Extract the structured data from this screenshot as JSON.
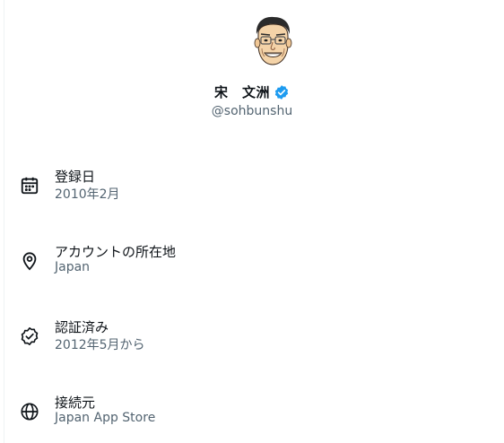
{
  "profile": {
    "display_name": "宋　文洲",
    "handle": "@sohbunshu",
    "verified_badge_icon": "verified-badge-icon",
    "verified_color": "#1d9bf0"
  },
  "details": [
    {
      "icon": "calendar-icon",
      "label": "登録日",
      "value": "2010年2月"
    },
    {
      "icon": "location-pin-icon",
      "label": "アカウントの所在地",
      "value": "Japan"
    },
    {
      "icon": "verified-check-icon",
      "label": "認証済み",
      "value": "2012年5月から"
    },
    {
      "icon": "globe-icon",
      "label": "接続元",
      "value": "Japan App Store"
    }
  ]
}
